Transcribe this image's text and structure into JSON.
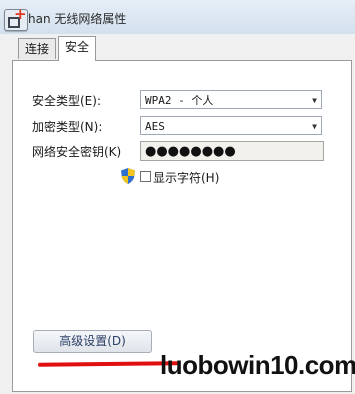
{
  "window": {
    "title": "han 无线网络属性"
  },
  "tabs": [
    {
      "label": "连接",
      "active": false
    },
    {
      "label": "安全",
      "active": true
    }
  ],
  "form": {
    "security_type_label": "安全类型(E):",
    "security_type_value": "WPA2 - 个人",
    "encryption_type_label": "加密类型(N):",
    "encryption_type_value": "AES",
    "network_key_label": "网络安全密钥(K)",
    "network_key_value": "●●●●●●●●",
    "show_chars_label": "显示字符(H)",
    "show_chars_checked": false
  },
  "buttons": {
    "advanced_label": "高级设置(D)"
  },
  "watermark": "luobowin10.com",
  "colors": {
    "annotation_line": "#e01010"
  }
}
